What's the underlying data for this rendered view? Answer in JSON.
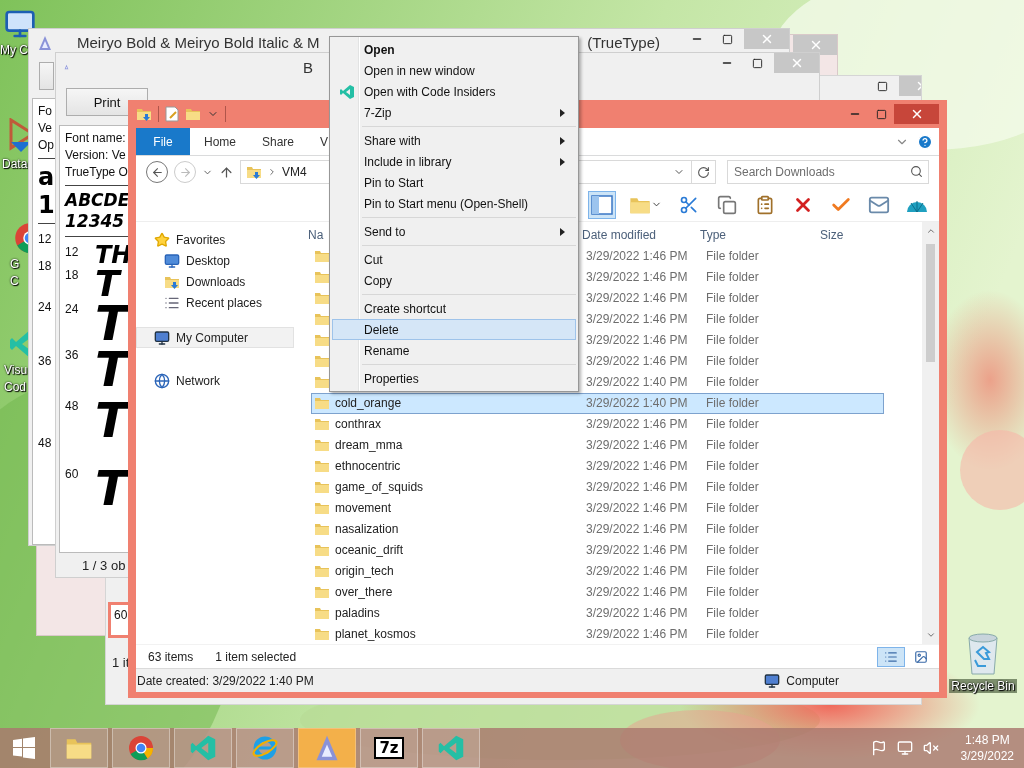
{
  "desktop_icons": [
    {
      "kind": "computer",
      "lines": [
        "My C"
      ]
    },
    {
      "kind": "database",
      "lines": [
        "Data"
      ]
    },
    {
      "kind": "chrome",
      "lines": [
        "G",
        "C"
      ]
    },
    {
      "kind": "vscode",
      "lines": [
        "Visu",
        "Cod"
      ]
    },
    {
      "kind": "recycle",
      "lines": [
        "Recycle Bin"
      ]
    }
  ],
  "font_viewer_back": {
    "title": "Meiryo Bold & Meiryo Bold Italic  & M",
    "title_end": "(TrueType)",
    "info": [
      "Fo",
      "Ve",
      "Op"
    ],
    "samples": [
      "a",
      "1"
    ],
    "sizes": [
      "12",
      "18",
      "24",
      "36",
      "48"
    ]
  },
  "font_viewer_front": {
    "title": "B",
    "print_button": "Print",
    "info": [
      "Font name:",
      "Version: Ve",
      "TrueType O"
    ],
    "samples": [
      "ABCDE",
      "12345"
    ],
    "previews": [
      {
        "size": "12",
        "text": "TH"
      },
      {
        "size": "18",
        "text": "T"
      },
      {
        "size": "24",
        "text": "T"
      },
      {
        "size": "36",
        "text": "T"
      },
      {
        "size": "48",
        "text": "T"
      },
      {
        "size": "60",
        "text": "T"
      }
    ],
    "status": "1 / 3 ob"
  },
  "font_viewer_third": {
    "preview_size": "60",
    "status": "1 it"
  },
  "explorer": {
    "tabs": [
      {
        "label": "File",
        "kind": "file"
      },
      {
        "label": "Home",
        "kind": "tab"
      },
      {
        "label": "Share",
        "kind": "tab"
      },
      {
        "label": "V",
        "kind": "tab"
      }
    ],
    "breadcrumbs": [
      "VM4"
    ],
    "search": {
      "placeholder": "Search Downloads"
    },
    "nav": [
      {
        "label": "Favorites",
        "kind": "favorites",
        "selected": false,
        "children": [
          {
            "label": "Desktop",
            "kind": "desktop",
            "selected": false
          },
          {
            "label": "Downloads",
            "kind": "downloads",
            "selected": false
          },
          {
            "label": "Recent places",
            "kind": "recent",
            "selected": false
          }
        ]
      },
      {
        "label": "My Computer",
        "kind": "computer",
        "selected": true
      },
      {
        "label": "Network",
        "kind": "network",
        "selected": false
      }
    ],
    "columns": [
      "Na",
      "Date modified",
      "Type",
      "Size"
    ],
    "rows": [
      {
        "date": "3/29/2022 1:46 PM",
        "type": "File folder",
        "selected": false
      },
      {
        "date": "3/29/2022 1:46 PM",
        "type": "File folder",
        "selected": false
      },
      {
        "date": "3/29/2022 1:46 PM",
        "type": "File folder",
        "selected": false
      },
      {
        "date": "3/29/2022 1:46 PM",
        "type": "File folder",
        "selected": false
      },
      {
        "date": "3/29/2022 1:46 PM",
        "type": "File folder",
        "selected": false
      },
      {
        "date": "3/29/2022 1:46 PM",
        "type": "File folder",
        "selected": false
      },
      {
        "date": "3/29/2022 1:40 PM",
        "type": "File folder",
        "selected": false
      },
      {
        "name": "cold_orange",
        "date": "3/29/2022 1:40 PM",
        "type": "File folder",
        "selected": true
      },
      {
        "name": "conthrax",
        "date": "3/29/2022 1:46 PM",
        "type": "File folder",
        "selected": false
      },
      {
        "name": "dream_mma",
        "date": "3/29/2022 1:46 PM",
        "type": "File folder",
        "selected": false
      },
      {
        "name": "ethnocentric",
        "date": "3/29/2022 1:46 PM",
        "type": "File folder",
        "selected": false
      },
      {
        "name": "game_of_squids",
        "date": "3/29/2022 1:46 PM",
        "type": "File folder",
        "selected": false
      },
      {
        "name": "movement",
        "date": "3/29/2022 1:46 PM",
        "type": "File folder",
        "selected": false
      },
      {
        "name": "nasalization",
        "date": "3/29/2022 1:46 PM",
        "type": "File folder",
        "selected": false
      },
      {
        "name": "oceanic_drift",
        "date": "3/29/2022 1:46 PM",
        "type": "File folder",
        "selected": false
      },
      {
        "name": "origin_tech",
        "date": "3/29/2022 1:46 PM",
        "type": "File folder",
        "selected": false
      },
      {
        "name": "over_there",
        "date": "3/29/2022 1:46 PM",
        "type": "File folder",
        "selected": false
      },
      {
        "name": "paladins",
        "date": "3/29/2022 1:46 PM",
        "type": "File folder",
        "selected": false
      },
      {
        "name": "planet_kosmos",
        "date": "3/29/2022 1:46 PM",
        "type": "File folder",
        "selected": false
      }
    ],
    "status": {
      "count": "63 items",
      "selection": "1 item selected"
    },
    "details": {
      "text": "Date created: 3/29/2022 1:40 PM",
      "location": "Computer"
    }
  },
  "context_menu": [
    {
      "kind": "item",
      "label": "Open",
      "bold": true,
      "has_icon": false,
      "submenu": false,
      "selected": false
    },
    {
      "kind": "item",
      "label": "Open in new window",
      "bold": false,
      "has_icon": false,
      "submenu": false,
      "selected": false
    },
    {
      "kind": "item",
      "label": "Open with Code Insiders",
      "bold": false,
      "has_icon": true,
      "submenu": false,
      "selected": false
    },
    {
      "kind": "item",
      "label": "7-Zip",
      "bold": false,
      "has_icon": false,
      "submenu": true,
      "selected": false
    },
    {
      "kind": "separator"
    },
    {
      "kind": "item",
      "label": "Share with",
      "bold": false,
      "has_icon": false,
      "submenu": true,
      "selected": false
    },
    {
      "kind": "item",
      "label": "Include in library",
      "bold": false,
      "has_icon": false,
      "submenu": true,
      "selected": false
    },
    {
      "kind": "item",
      "label": "Pin to Start",
      "bold": false,
      "has_icon": false,
      "submenu": false,
      "selected": false
    },
    {
      "kind": "item",
      "label": "Pin to Start menu (Open-Shell)",
      "bold": false,
      "has_icon": false,
      "submenu": false,
      "selected": false
    },
    {
      "kind": "separator"
    },
    {
      "kind": "item",
      "label": "Send to",
      "bold": false,
      "has_icon": false,
      "submenu": true,
      "selected": false
    },
    {
      "kind": "separator"
    },
    {
      "kind": "item",
      "label": "Cut",
      "bold": false,
      "has_icon": false,
      "submenu": false,
      "selected": false
    },
    {
      "kind": "item",
      "label": "Copy",
      "bold": false,
      "has_icon": false,
      "submenu": false,
      "selected": false
    },
    {
      "kind": "separator"
    },
    {
      "kind": "item",
      "label": "Create shortcut",
      "bold": false,
      "has_icon": false,
      "submenu": false,
      "selected": false
    },
    {
      "kind": "item",
      "label": "Delete",
      "bold": false,
      "has_icon": false,
      "submenu": false,
      "selected": true
    },
    {
      "kind": "item",
      "label": "Rename",
      "bold": false,
      "has_icon": false,
      "submenu": false,
      "selected": false
    },
    {
      "kind": "separator"
    },
    {
      "kind": "item",
      "label": "Properties",
      "bold": false,
      "has_icon": false,
      "submenu": false,
      "selected": false
    }
  ],
  "taskbar": {
    "apps": [
      {
        "kind": "explorer",
        "active": false
      },
      {
        "kind": "chrome",
        "active": false
      },
      {
        "kind": "vscode",
        "active": false
      },
      {
        "kind": "ie",
        "active": false
      },
      {
        "kind": "fontviewer",
        "active": true
      },
      {
        "kind": "archive",
        "label": "7z",
        "active": false
      },
      {
        "kind": "vscode",
        "active": false
      }
    ],
    "time": "1:48 PM",
    "date": "3/29/2022"
  }
}
